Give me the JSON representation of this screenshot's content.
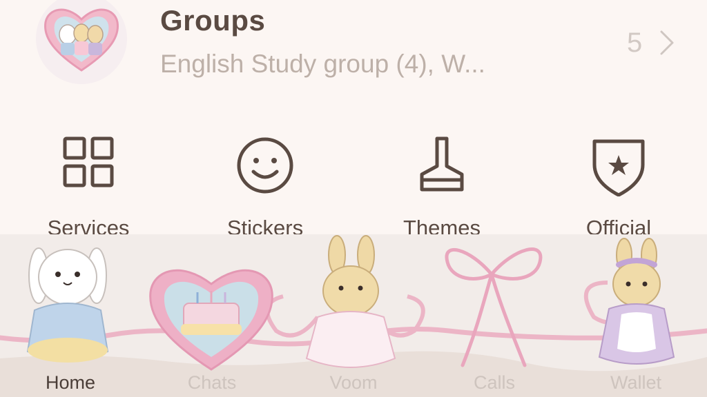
{
  "groups": {
    "title": "Groups",
    "subtitle": "English Study group (4), W...",
    "count": "5"
  },
  "actions": [
    {
      "label": "Services",
      "icon": "grid-icon"
    },
    {
      "label": "Stickers",
      "icon": "smiley-icon"
    },
    {
      "label": "Themes",
      "icon": "brush-icon"
    },
    {
      "label": "Official",
      "icon": "shield-star-icon"
    }
  ],
  "tabs": [
    {
      "label": "Home",
      "active": true
    },
    {
      "label": "Chats",
      "active": false
    },
    {
      "label": "Voom",
      "active": false
    },
    {
      "label": "Calls",
      "active": false
    },
    {
      "label": "Wallet",
      "active": false
    }
  ],
  "colors": {
    "background": "#fcf6f3",
    "text_primary": "#5a4a42",
    "text_muted": "#bdb0a8",
    "ribbon_pink": "#e9a6bd",
    "tab_inactive": "#cec4be"
  }
}
